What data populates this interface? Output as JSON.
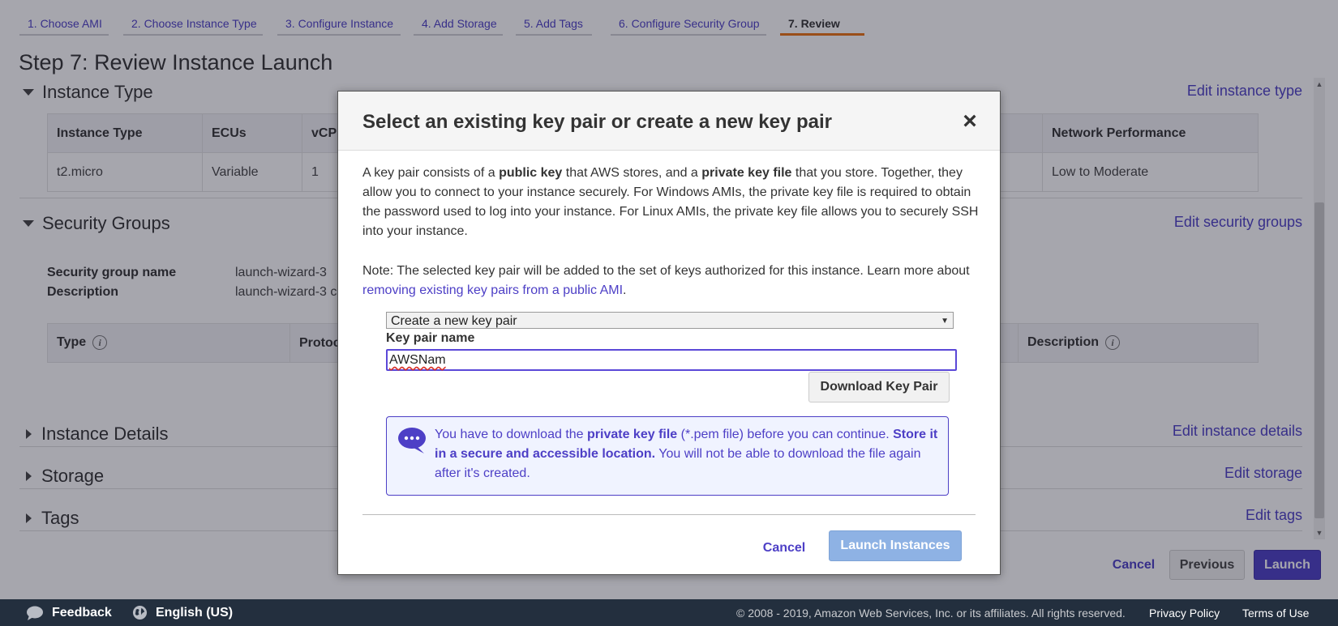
{
  "wizard": {
    "steps": [
      {
        "label": "1. Choose AMI"
      },
      {
        "label": "2. Choose Instance Type"
      },
      {
        "label": "3. Configure Instance"
      },
      {
        "label": "4. Add Storage"
      },
      {
        "label": "5. Add Tags"
      },
      {
        "label": "6. Configure Security Group"
      },
      {
        "label": "7. Review"
      }
    ],
    "active_step": "7. Review",
    "accent_color": "#ec7211"
  },
  "page_title": "Step 7: Review Instance Launch",
  "sections": {
    "instance_type": {
      "title": "Instance Type",
      "edit": "Edit instance type",
      "columns": [
        "Instance Type",
        "ECUs",
        "vCPU",
        "Network Performance"
      ],
      "row": [
        "t2.micro",
        "Variable",
        "1",
        "Low to Moderate"
      ]
    },
    "security_groups": {
      "title": "Security Groups",
      "edit": "Edit security groups",
      "name_label": "Security group name",
      "name_value": "launch-wizard-3",
      "description_label": "Description",
      "description_value": "launch-wizard-3 c",
      "columns": [
        "Type",
        "Protoc",
        "Description"
      ]
    },
    "instance_details": {
      "title": "Instance Details",
      "edit": "Edit instance details"
    },
    "storage": {
      "title": "Storage",
      "edit": "Edit storage"
    },
    "tags": {
      "title": "Tags",
      "edit": "Edit tags"
    }
  },
  "actions": {
    "cancel": "Cancel",
    "previous": "Previous",
    "launch": "Launch"
  },
  "footer": {
    "feedback": "Feedback",
    "language": "English (US)",
    "copyright": "© 2008 - 2019, Amazon Web Services, Inc. or its affiliates. All rights reserved.",
    "privacy": "Privacy Policy",
    "terms": "Terms of Use"
  },
  "modal": {
    "title": "Select an existing key pair or create a new key pair",
    "close": "×",
    "para1": {
      "t1": "A key pair consists of a ",
      "b1": "public key",
      "t2": " that AWS stores, and a ",
      "b2": "private key file",
      "t3": " that you store. Together, they allow you to connect to your instance securely. For Windows AMIs, the private key file is required to obtain the password used to log into your instance. For Linux AMIs, the private key file allows you to securely SSH into your instance."
    },
    "note": {
      "text": "Note: The selected key pair will be added to the set of keys authorized for this instance. Learn more about ",
      "link": "removing existing key pairs from a public AMI",
      "end": "."
    },
    "select_value": "Create a new key pair",
    "key_pair_label": "Key pair name",
    "key_pair_value": "AWSNam",
    "download_button": "Download Key Pair",
    "notice": {
      "t1": "You have to download the ",
      "b1": "private key file",
      "t2": " (*.pem file) before you can continue. ",
      "b2": "Store it in a secure and accessible location.",
      "t3": " You will not be able to download the file again after it's created."
    },
    "cancel": "Cancel",
    "launch_instances": "Launch Instances"
  }
}
